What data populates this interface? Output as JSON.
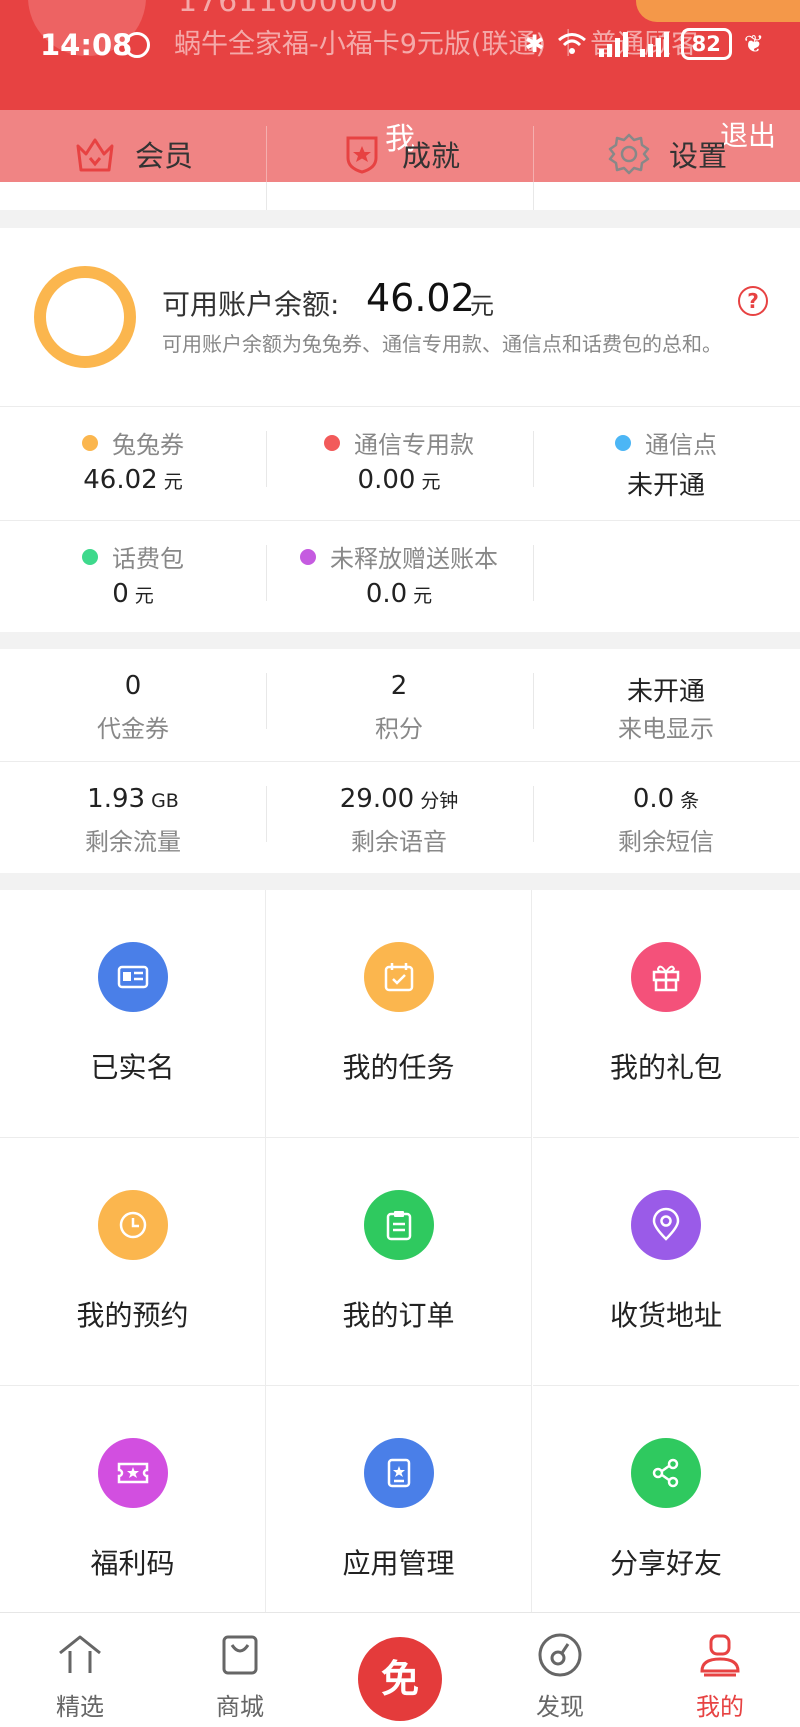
{
  "status_bar": {
    "time": "14:08",
    "battery": "82"
  },
  "header": {
    "phone_ghost": "17611000000",
    "plan_ghost": "蜗牛全家福-小福卡9元版(联通) ｜ 普通顾客",
    "title": "我",
    "logout": "退出",
    "menu": [
      {
        "label": "会员",
        "icon": "crown-icon"
      },
      {
        "label": "成就",
        "icon": "badge-icon"
      },
      {
        "label": "设置",
        "icon": "gear-icon"
      }
    ]
  },
  "balance": {
    "label": "可用账户余额:",
    "value": "46.02",
    "unit": "元",
    "description": "可用账户余额为兔兔券、通信专用款、通信点和话费包的总和。",
    "help": "?"
  },
  "accounts": [
    {
      "name": "兔兔券",
      "value": "46.02",
      "unit": "元",
      "color": "#fbb64e"
    },
    {
      "name": "通信专用款",
      "value": "0.00",
      "unit": "元",
      "color": "#f25a5a"
    },
    {
      "name": "通信点",
      "value": "未开通",
      "unit": "",
      "color": "#4cb6f5"
    },
    {
      "name": "话费包",
      "value": "0",
      "unit": "元",
      "color": "#3ed98c"
    },
    {
      "name": "未释放赠送账本",
      "value": "0.0",
      "unit": "元",
      "color": "#c55be0"
    }
  ],
  "stats": [
    {
      "value": "0",
      "unit": "",
      "label": "代金券"
    },
    {
      "value": "2",
      "unit": "",
      "label": "积分"
    },
    {
      "value": "未开通",
      "unit": "",
      "label": "来电显示"
    },
    {
      "value": "1.93",
      "unit": "GB",
      "label": "剩余流量"
    },
    {
      "value": "29.00",
      "unit": "分钟",
      "label": "剩余语音"
    },
    {
      "value": "0.0",
      "unit": "条",
      "label": "剩余短信"
    }
  ],
  "grid": [
    {
      "label": "已实名",
      "icon": "id-card-icon",
      "color": "#4a7fe8"
    },
    {
      "label": "我的任务",
      "icon": "calendar-check-icon",
      "color": "#fbb64e"
    },
    {
      "label": "我的礼包",
      "icon": "gift-icon",
      "color": "#f4517a"
    },
    {
      "label": "我的预约",
      "icon": "clock-icon",
      "color": "#fbb64e"
    },
    {
      "label": "我的订单",
      "icon": "clipboard-icon",
      "color": "#2fc95f"
    },
    {
      "label": "收货地址",
      "icon": "location-icon",
      "color": "#9a5be8"
    },
    {
      "label": "福利码",
      "icon": "ticket-icon",
      "color": "#d24fe0"
    },
    {
      "label": "应用管理",
      "icon": "app-star-icon",
      "color": "#4a7fe8"
    },
    {
      "label": "分享好友",
      "icon": "share-icon",
      "color": "#2fc95f"
    }
  ],
  "tabbar": {
    "tabs": [
      {
        "label": "精选",
        "icon": "home-icon"
      },
      {
        "label": "商城",
        "icon": "shopping-bag-icon"
      },
      {
        "label": "发现",
        "icon": "compass-icon"
      },
      {
        "label": "我的",
        "icon": "user-icon"
      }
    ],
    "center": "免",
    "active_color": "#e74242"
  }
}
